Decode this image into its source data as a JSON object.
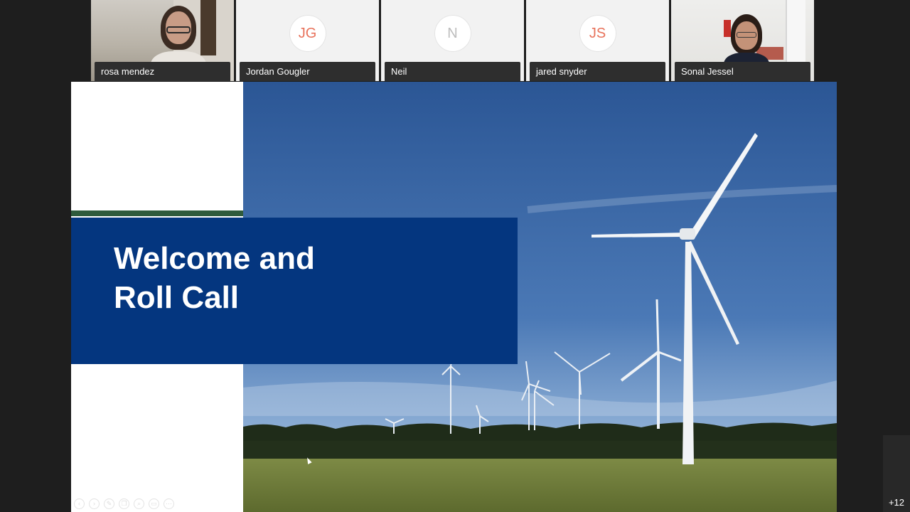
{
  "participants": [
    {
      "name": "rosa mendez",
      "type": "video"
    },
    {
      "name": "Jordan Gougler",
      "type": "avatar",
      "initials": "JG",
      "color": "#e8735c"
    },
    {
      "name": "Neil",
      "type": "avatar",
      "initials": "N",
      "color": "#bdbdbd"
    },
    {
      "name": "jared snyder",
      "type": "avatar",
      "initials": "JS",
      "color": "#e8735c"
    },
    {
      "name": "Sonal Jessel",
      "type": "video"
    }
  ],
  "slide": {
    "title_line1": "Welcome and",
    "title_line2": "Roll Call",
    "band_color": "#04367f",
    "accent_color": "#2f5b3c",
    "tool_icons": [
      "prev-icon",
      "next-icon",
      "pen-icon",
      "copy-icon",
      "zoom-icon",
      "subtitles-icon",
      "more-icon"
    ]
  },
  "overflow_count": "+12"
}
